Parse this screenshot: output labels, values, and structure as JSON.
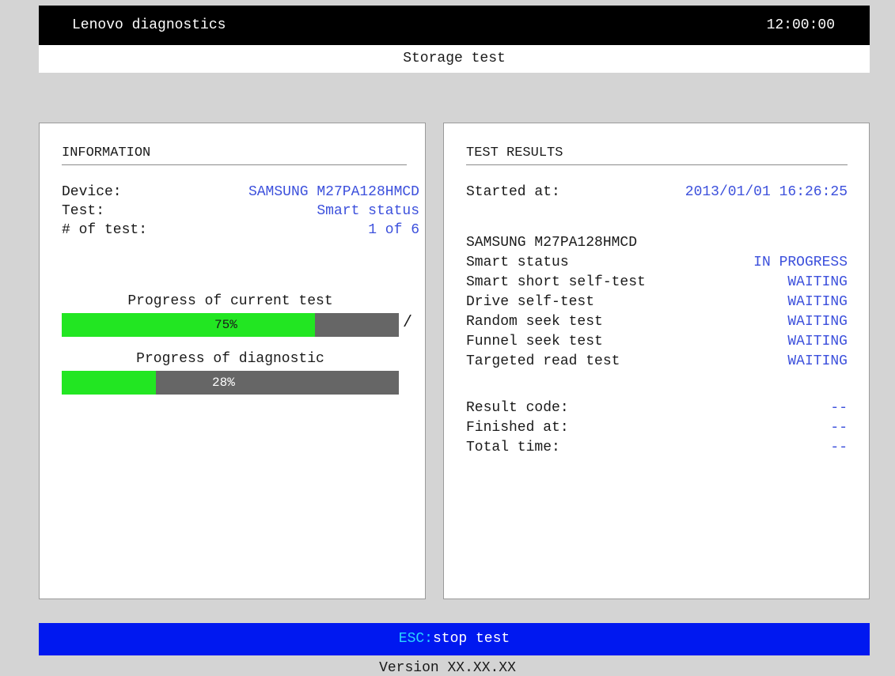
{
  "header": {
    "app_title": "Lenovo diagnostics",
    "clock": "12:00:00",
    "subtitle": "Storage test"
  },
  "information": {
    "heading": "INFORMATION",
    "rows": [
      {
        "label": "Device:",
        "value": "SAMSUNG M27PA128HMCD"
      },
      {
        "label": "Test:",
        "value": "Smart status"
      },
      {
        "label": "# of test:",
        "value": "1 of 6"
      }
    ],
    "current_progress": {
      "title": "Progress of current test",
      "percent": 75,
      "text": "75%"
    },
    "diagnostic_progress": {
      "title": "Progress of diagnostic",
      "percent": 28,
      "text": "28%"
    },
    "spinner": "/"
  },
  "results": {
    "heading": "TEST RESULTS",
    "started": {
      "label": "Started at:",
      "value": "2013/01/01 16:26:25"
    },
    "device_name": "SAMSUNG M27PA128HMCD",
    "tests": [
      {
        "label": "Smart status",
        "status": "IN PROGRESS"
      },
      {
        "label": "Smart short self-test",
        "status": "WAITING"
      },
      {
        "label": "Drive self-test",
        "status": "WAITING"
      },
      {
        "label": "Random seek test",
        "status": "WAITING"
      },
      {
        "label": "Funnel seek test",
        "status": "WAITING"
      },
      {
        "label": "Targeted read test",
        "status": "WAITING"
      }
    ],
    "summary": [
      {
        "label": "Result code:",
        "value": "--"
      },
      {
        "label": "Finished at:",
        "value": "--"
      },
      {
        "label": "Total time:",
        "value": "--"
      }
    ]
  },
  "footer": {
    "key": "ESC:",
    "action": "stop test",
    "version": "Version XX.XX.XX"
  },
  "colors": {
    "value_blue": "#3c50dc",
    "progress_green": "#22e622",
    "footer_blue": "#0018f0"
  }
}
